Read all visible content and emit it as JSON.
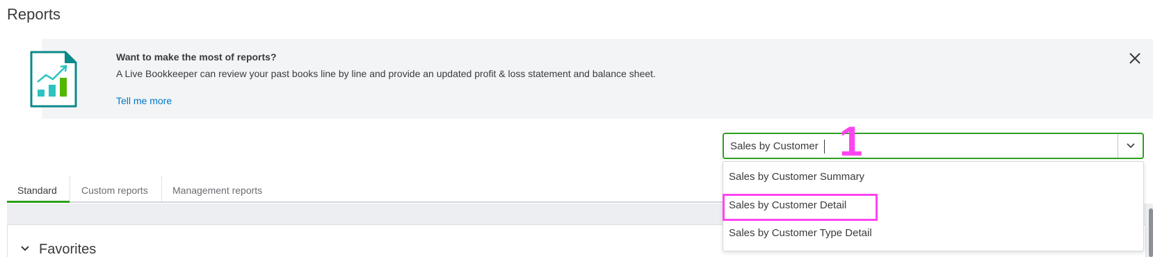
{
  "page": {
    "title": "Reports"
  },
  "banner": {
    "heading": "Want to make the most of reports?",
    "body": "A Live Bookkeeper can review your past books line by line and provide an updated profit & loss statement and balance sheet.",
    "link": "Tell me more",
    "illustration_icon": "report-growth-chart-icon",
    "close_icon": "close-icon"
  },
  "search": {
    "value": "Sales by Customer",
    "dropdown_icon": "chevron-down-icon",
    "suggestions": [
      "Sales by Customer Summary",
      "Sales by Customer Detail",
      "Sales by Customer Type Detail"
    ]
  },
  "annotation": {
    "step_number": "1"
  },
  "tabs": [
    "Standard",
    "Custom reports",
    "Management reports"
  ],
  "favorites": {
    "label": "Favorites"
  },
  "colors": {
    "accent_green": "#2ca01c",
    "link_blue": "#0077c5",
    "annotation_magenta": "#ff45f0",
    "banner_bg": "#f3f4f6",
    "teal": "#00a6a4",
    "text": "#393a3d"
  }
}
